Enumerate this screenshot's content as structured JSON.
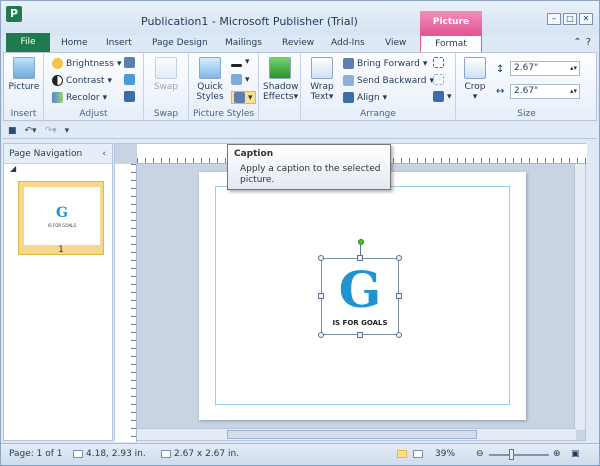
{
  "window": {
    "title": "Publication1 - Microsoft Publisher (Trial)",
    "app_icon_letter": "P",
    "contextual_group": "Picture Tools"
  },
  "tabs": [
    {
      "label": "File"
    },
    {
      "label": "Home"
    },
    {
      "label": "Insert"
    },
    {
      "label": "Page Design"
    },
    {
      "label": "Mailings"
    },
    {
      "label": "Review"
    },
    {
      "label": "Add-Ins"
    },
    {
      "label": "View"
    },
    {
      "label": "Format"
    }
  ],
  "ribbon": {
    "insert_group": {
      "label": "Insert",
      "picture": "Picture"
    },
    "adjust_group": {
      "label": "Adjust",
      "brightness": "Brightness",
      "contrast": "Contrast",
      "recolor": "Recolor"
    },
    "swap_group": {
      "label": "Swap",
      "swap": "Swap"
    },
    "styles_group": {
      "label": "Picture Styles",
      "quick_styles_line1": "Quick",
      "quick_styles_line2": "Styles"
    },
    "shadow_group": {
      "shadow_line1": "Shadow",
      "shadow_line2": "Effects"
    },
    "arrange_group": {
      "label": "Arrange",
      "wrap_line1": "Wrap",
      "wrap_line2": "Text",
      "bring_forward": "Bring Forward",
      "send_backward": "Send Backward",
      "align": "Align"
    },
    "size_group": {
      "label": "Size",
      "crop": "Crop",
      "height": "2.67\"",
      "width": "2.67\""
    }
  },
  "tooltip": {
    "title": "Caption",
    "body": "Apply a caption to the selected picture."
  },
  "navigation": {
    "title": "Page Navigation",
    "page_number": "1",
    "thumb_letter": "G"
  },
  "picture": {
    "letter": "G",
    "caption": "IS FOR GOALS"
  },
  "status": {
    "page": "Page: 1 of 1",
    "position": "4.18, 2.93 in.",
    "size": "2.67 x 2.67 in.",
    "zoom": "39%"
  },
  "colors": {
    "file_tab": "#1f7a4d",
    "contextual": "#e35594",
    "logo_blue": "#1f94cf"
  }
}
